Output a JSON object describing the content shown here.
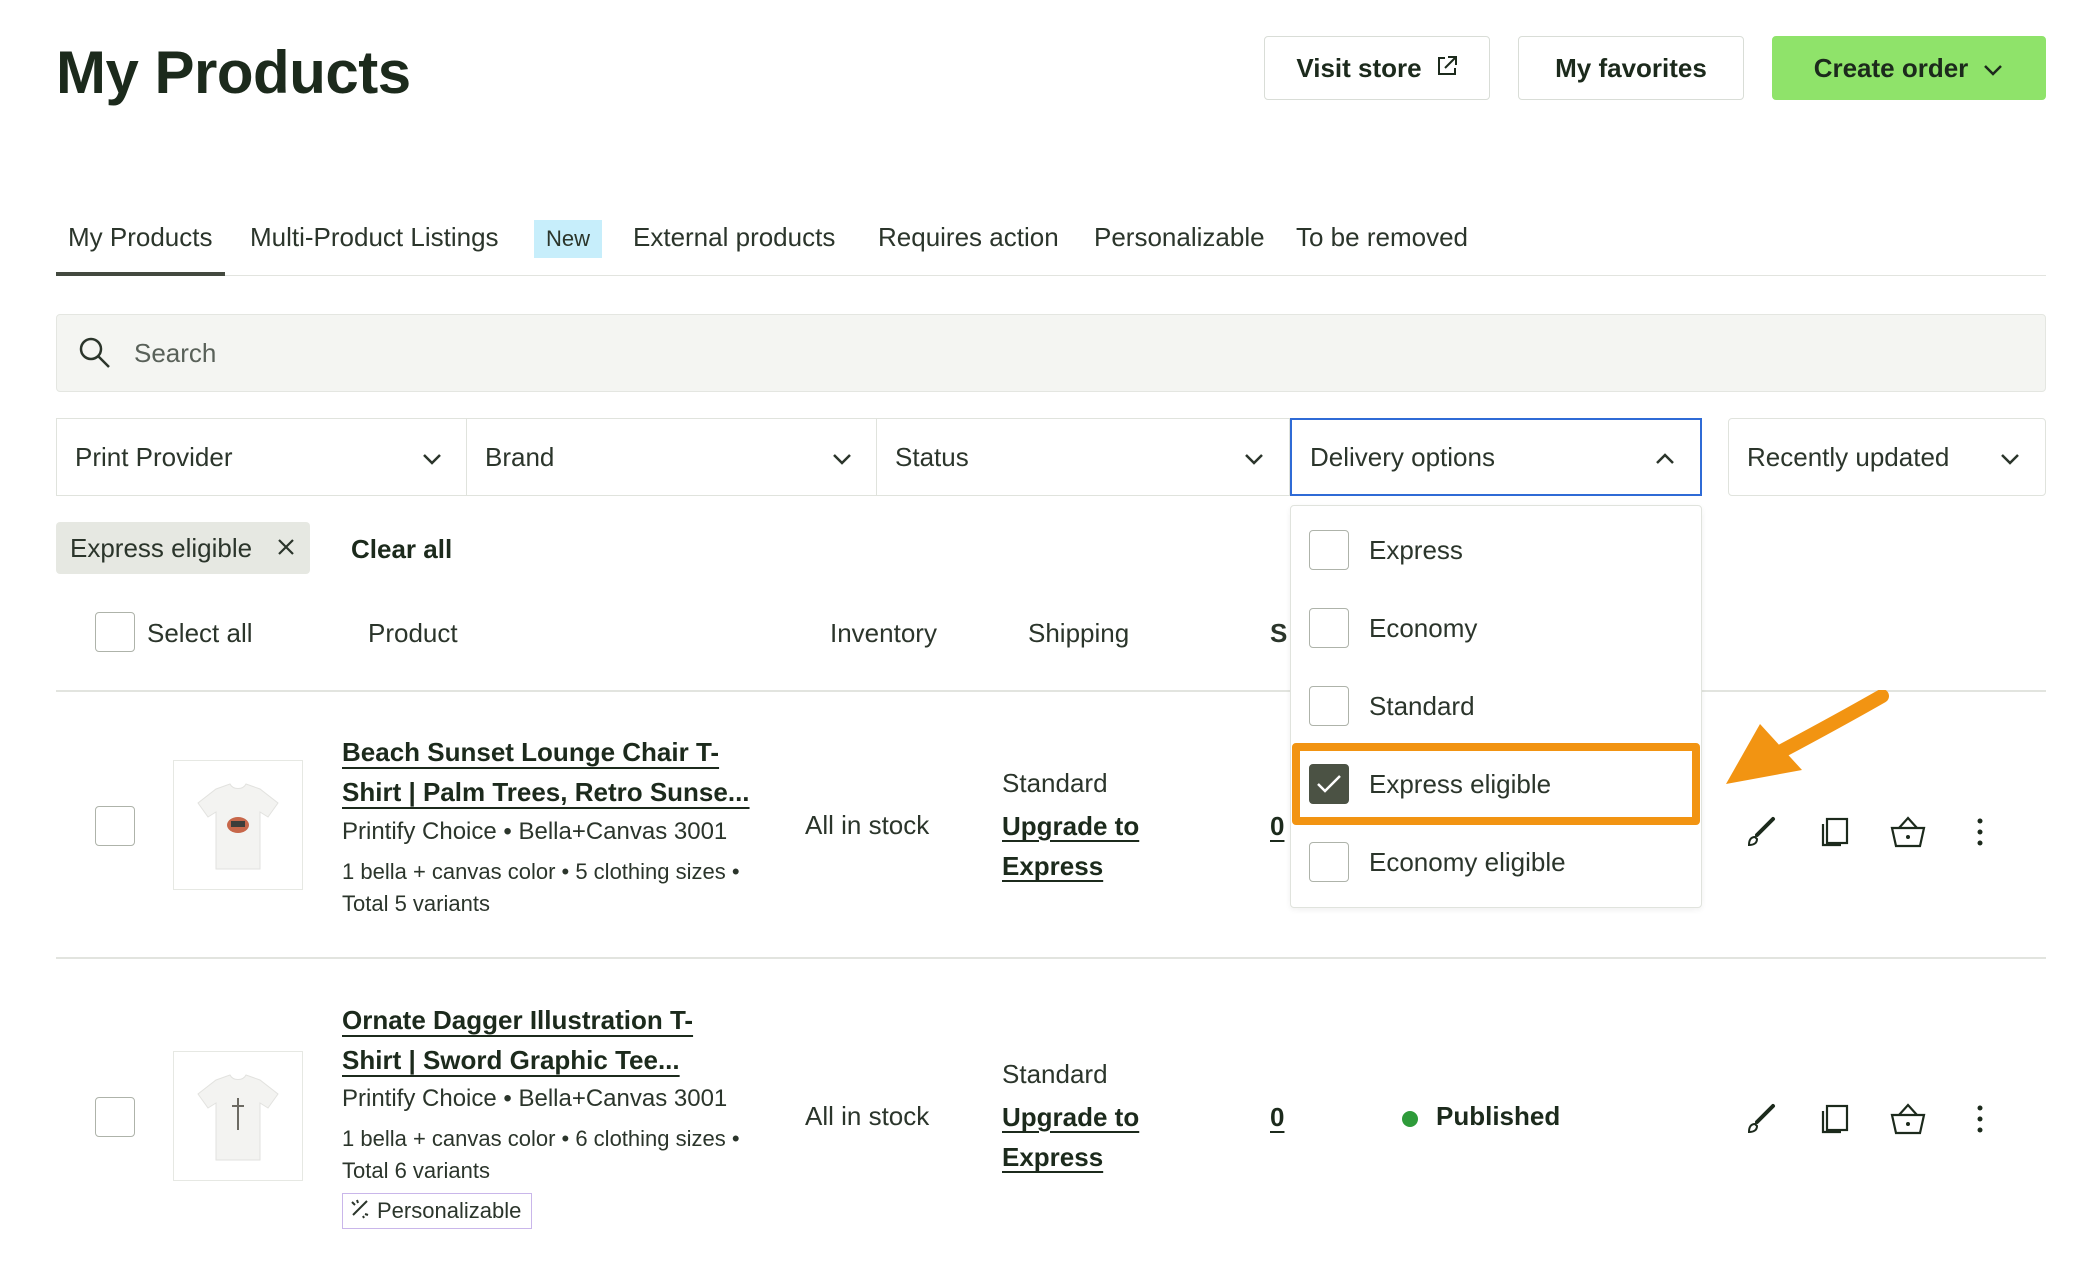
{
  "header": {
    "title": "My Products",
    "visit_store": "Visit store",
    "my_favorites": "My favorites",
    "create_order": "Create order"
  },
  "tabs": [
    {
      "label": "My Products",
      "active": true
    },
    {
      "label": "Multi-Product Listings",
      "badge": "New"
    },
    {
      "label": "External products"
    },
    {
      "label": "Requires action"
    },
    {
      "label": "Personalizable"
    },
    {
      "label": "To be removed"
    }
  ],
  "search": {
    "placeholder": "Search"
  },
  "filters": {
    "print_provider": "Print Provider",
    "brand": "Brand",
    "status": "Status",
    "delivery_options": "Delivery options",
    "sort": "Recently updated"
  },
  "active_filters": {
    "chip": "Express eligible",
    "clear_all": "Clear all"
  },
  "table_header": {
    "select_all": "Select all",
    "product": "Product",
    "inventory": "Inventory",
    "shipping": "Shipping",
    "status_partial": "S"
  },
  "delivery_dropdown": {
    "options": [
      {
        "label": "Express",
        "checked": false
      },
      {
        "label": "Economy",
        "checked": false
      },
      {
        "label": "Standard",
        "checked": false
      },
      {
        "label": "Express eligible",
        "checked": true
      },
      {
        "label": "Economy eligible",
        "checked": false
      }
    ]
  },
  "rows": [
    {
      "title_line1": "Beach Sunset Lounge Chair T-",
      "title_line2": "Shirt | Palm Trees, Retro Sunse...",
      "provider": "Printify Choice • Bella+Canvas 3001",
      "variants_line1": "1 bella + canvas color • 5 clothing sizes •",
      "variants_line2": "Total 5 variants",
      "inventory": "All in stock",
      "shipping": "Standard",
      "upgrade_line1": "Upgrade to",
      "upgrade_line2": "Express",
      "count": "0"
    },
    {
      "title_line1": "Ornate Dagger Illustration T-",
      "title_line2": "Shirt | Sword Graphic Tee...",
      "provider": "Printify Choice • Bella+Canvas 3001",
      "variants_line1": "1 bella + canvas color • 6 clothing sizes •",
      "variants_line2": "Total 6 variants",
      "personalizable": "Personalizable",
      "inventory": "All in stock",
      "shipping": "Standard",
      "upgrade_line1": "Upgrade to",
      "upgrade_line2": "Express",
      "count": "0",
      "status": "Published"
    }
  ],
  "colors": {
    "primary_green": "#8fe36a",
    "published_dot": "#2e9b3a",
    "highlight_orange": "#f29412",
    "focus_blue": "#2f6bd6"
  }
}
